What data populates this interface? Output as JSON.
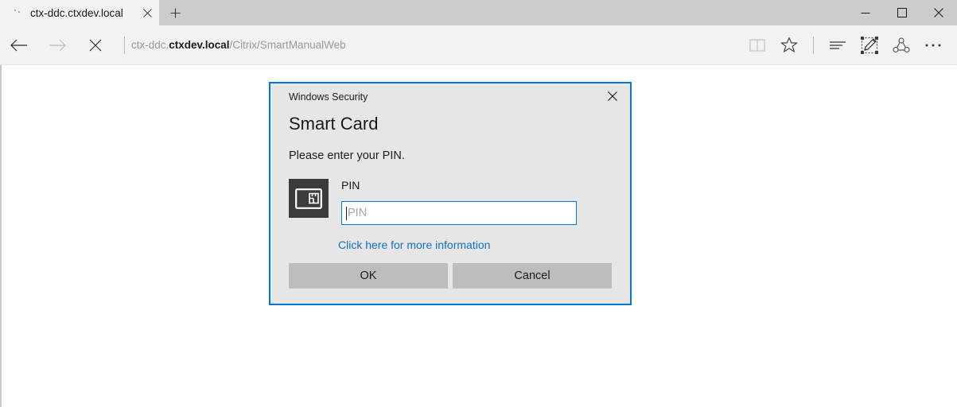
{
  "window": {
    "tab": {
      "title": "ctx-ddc.ctxdev.local",
      "favicon": "loading-dots-icon",
      "close_icon": "close-icon"
    },
    "new_tab_icon": "plus-icon",
    "controls": {
      "minimize_icon": "minimize-icon",
      "maximize_icon": "maximize-icon",
      "close_icon": "close-icon"
    }
  },
  "navbar": {
    "back_icon": "back-arrow-icon",
    "forward_icon": "forward-arrow-icon",
    "stop_icon": "stop-icon",
    "url": {
      "prefix": "ctx-ddc.",
      "domain": "ctxdev.local",
      "path": "/Citrix/SmartManualWeb"
    },
    "tools": [
      {
        "name": "reading-view-icon",
        "label": "Reading view"
      },
      {
        "name": "favorites-star-icon",
        "label": "Add to favorites"
      },
      {
        "name": "hub-icon",
        "label": "Hub"
      },
      {
        "name": "web-note-icon",
        "label": "Make a Web Note"
      },
      {
        "name": "share-icon",
        "label": "Share"
      },
      {
        "name": "more-icon",
        "label": "Settings and more"
      }
    ]
  },
  "dialog": {
    "subtitle": "Windows Security",
    "title": "Smart Card",
    "description": "Please enter your PIN.",
    "close_icon": "close-icon",
    "card_icon": "smart-card-icon",
    "pin_label": "PIN",
    "pin_value": "",
    "pin_placeholder": "PIN",
    "link_text": "Click here for more information",
    "ok_label": "OK",
    "cancel_label": "Cancel"
  },
  "colors": {
    "accent": "#0078d7",
    "link": "#0f72c4",
    "dialog_bg": "#e6e6e6",
    "button_bg": "#bdbdbd",
    "titlebar_bg": "#cccccc",
    "navbar_bg": "#f2f2f2",
    "card_icon_bg": "#3b3b3b"
  }
}
